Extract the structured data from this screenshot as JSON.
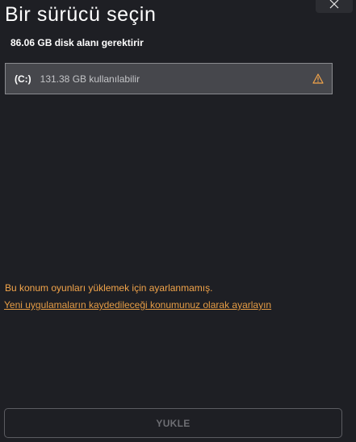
{
  "dialog": {
    "title": "Bir sürücü seçin",
    "required_space": "86.06 GB disk alanı gerektirir"
  },
  "drive": {
    "letter": "(C:)",
    "free_space": "131.38 GB kullanılabilir",
    "status_icon": "warning-icon"
  },
  "message": {
    "warning": "Bu konum oyunları yüklemek için ayarlanmamış.",
    "link": "Yeni uygulamaların kaydedileceği konumunuz olarak ayarlayın"
  },
  "actions": {
    "install_label": "YUKLE",
    "close_icon": "close-icon"
  },
  "colors": {
    "background": "#1e1f24",
    "warning": "#f2a44a",
    "drive_bg": "#46474c"
  }
}
